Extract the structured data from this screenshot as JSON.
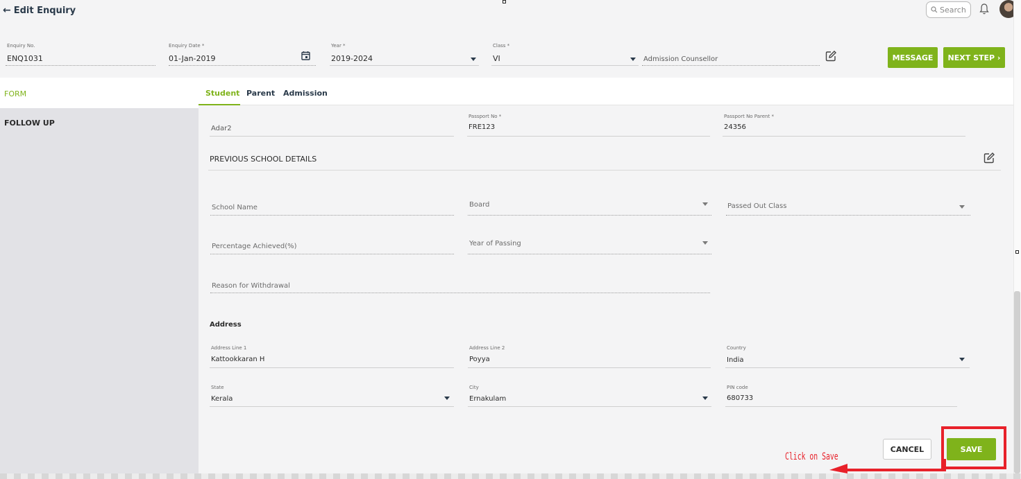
{
  "header": {
    "back_arrow": "←",
    "title": "Edit Enquiry",
    "search_placeholder": "Search"
  },
  "top_fields": {
    "enquiry_no": {
      "label": "Enquiry No.",
      "value": "ENQ1031"
    },
    "enquiry_date": {
      "label": "Enquiry Date *",
      "value": "01-Jan-2019"
    },
    "year": {
      "label": "Year *",
      "value": "2019-2024"
    },
    "class": {
      "label": "Class *",
      "value": "VI"
    },
    "counsellor": {
      "placeholder": "Admission Counsellor"
    }
  },
  "buttons": {
    "message": "MESSAGE",
    "next_step": "NEXT STEP ›",
    "cancel": "CANCEL",
    "save": "SAVE"
  },
  "sidebar": {
    "items": [
      {
        "label": "FORM"
      },
      {
        "label": "FOLLOW UP"
      }
    ]
  },
  "tabs": [
    {
      "label": "Student",
      "active": true
    },
    {
      "label": "Parent",
      "active": false
    },
    {
      "label": "Admission",
      "active": false
    }
  ],
  "student": {
    "adar": {
      "value": "Adar2"
    },
    "passport_no": {
      "label": "Passport No *",
      "value": "FRE123"
    },
    "passport_parent": {
      "label": "Passport No Parent *",
      "value": "24356"
    }
  },
  "previous_school": {
    "title": "PREVIOUS SCHOOL DETAILS",
    "school_name": "School Name",
    "board": "Board",
    "passed_out_class": "Passed Out Class",
    "percentage": "Percentage Achieved(%)",
    "year_of_passing": "Year of Passing",
    "reason": "Reason for Withdrawal"
  },
  "address": {
    "title": "Address",
    "line1": {
      "label": "Address Line 1",
      "value": "Kattookkaran H"
    },
    "line2": {
      "label": "Address Line 2",
      "value": "Poyya"
    },
    "country": {
      "label": "Country",
      "value": "India"
    },
    "state": {
      "label": "State",
      "value": "Kerala"
    },
    "city": {
      "label": "City",
      "value": "Ernakulam"
    },
    "pin": {
      "label": "PIN code",
      "value": "680733"
    }
  },
  "annotation": {
    "text": "Click on Save"
  },
  "colors": {
    "accent": "#7fb31b",
    "annotation": "#e8212a"
  }
}
